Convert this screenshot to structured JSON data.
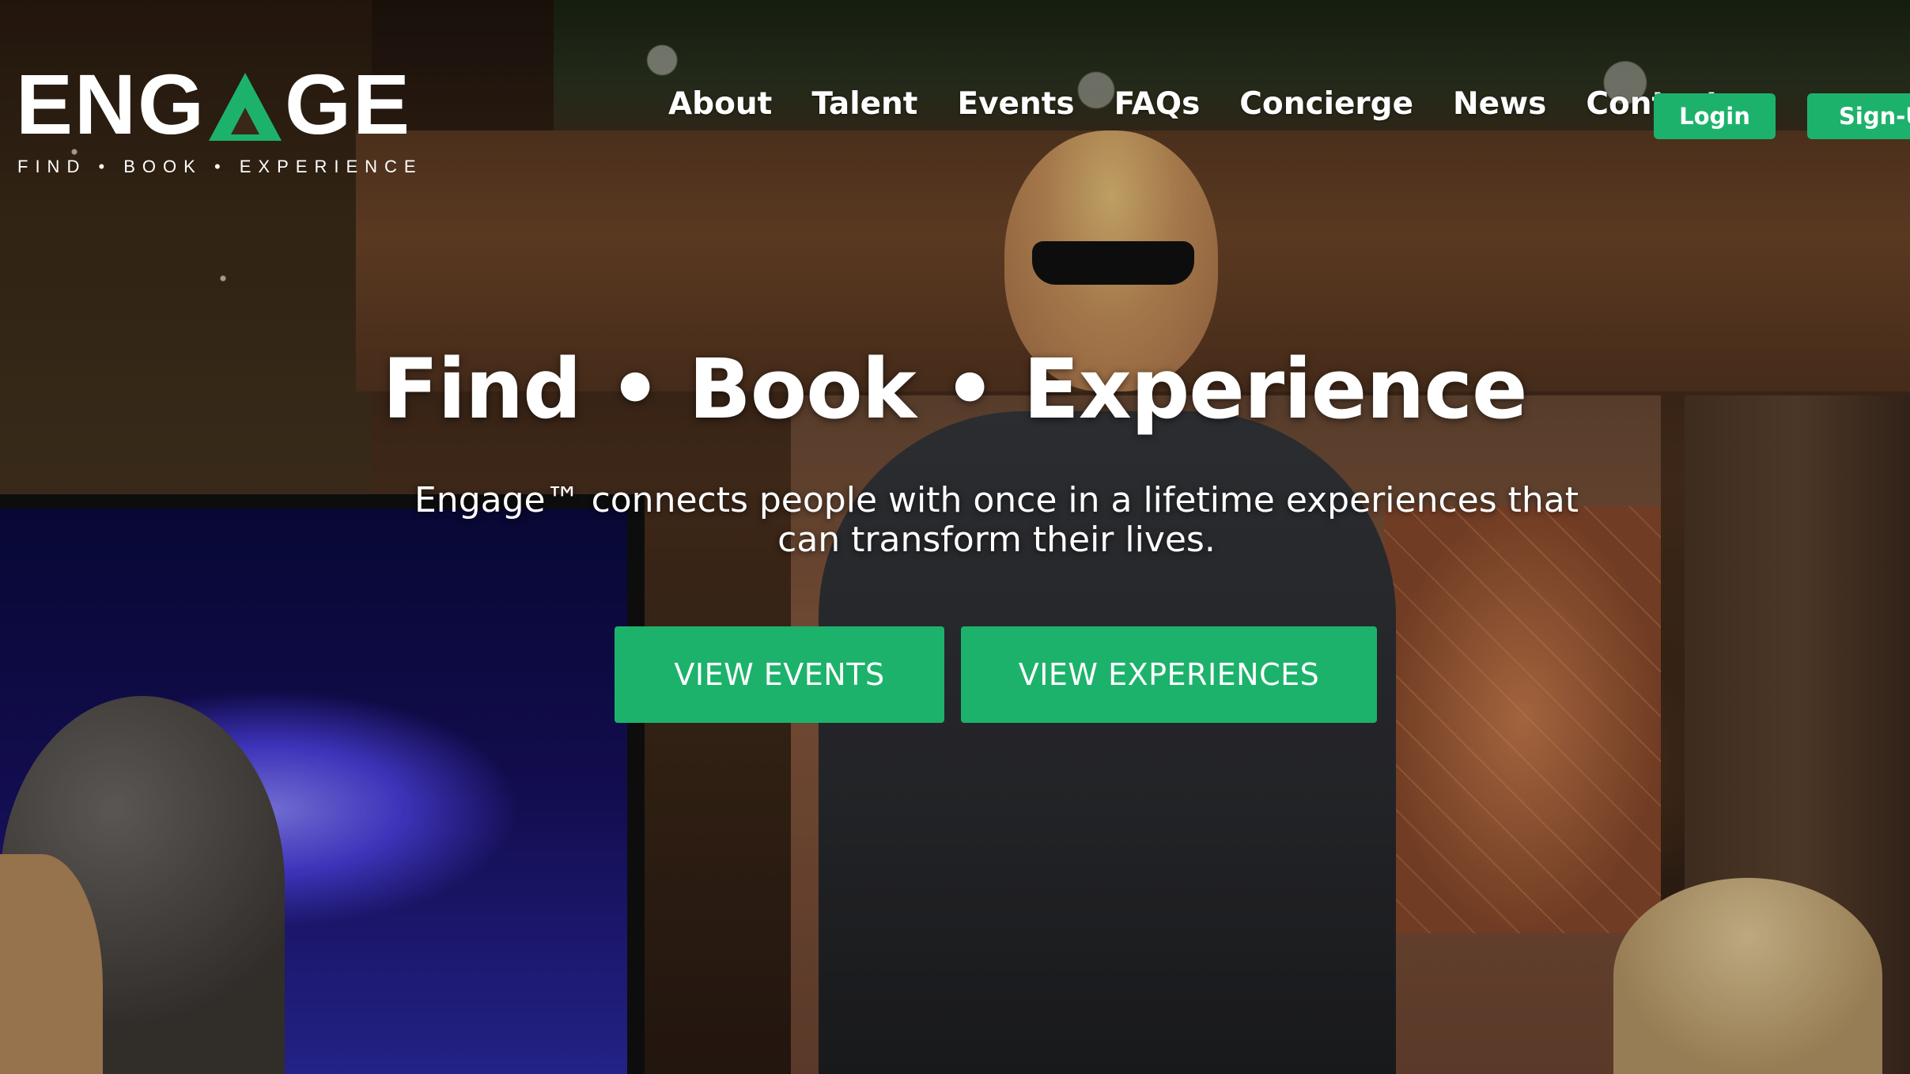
{
  "logo": {
    "word_before": "ENG",
    "word_after": "GE",
    "tagline": "FIND • BOOK • EXPERIENCE"
  },
  "nav": {
    "items": [
      "About",
      "Talent",
      "Events",
      "FAQs",
      "Concierge",
      "News",
      "Contact"
    ],
    "login_label": "Login",
    "signup_label": "Sign-Up"
  },
  "hero": {
    "title": "Find • Book • Experience",
    "subtitle": "Engage™ connects people with once in a lifetime experiences that can transform their lives.",
    "cta_events": "VIEW EVENTS",
    "cta_experiences": "VIEW EXPERIENCES"
  },
  "colors": {
    "accent": "#1db26b",
    "text": "#ffffff"
  }
}
